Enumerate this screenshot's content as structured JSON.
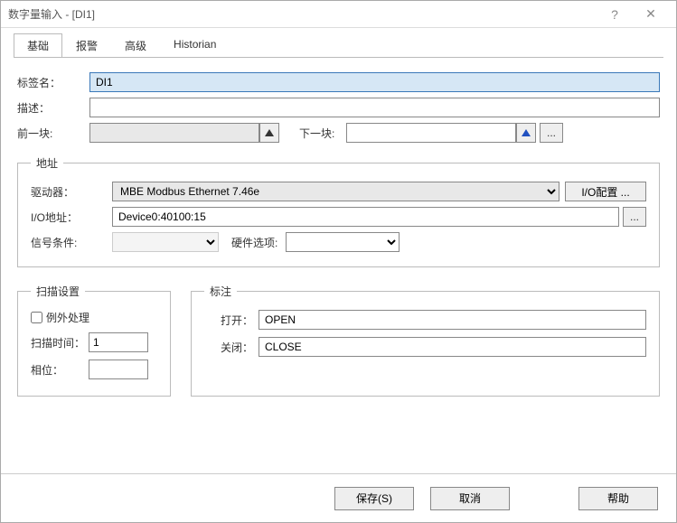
{
  "window": {
    "title": "数字量输入 - [DI1]"
  },
  "tabs": [
    "基础",
    "报警",
    "高级",
    "Historian"
  ],
  "active_tab_index": 0,
  "fields": {
    "tag_label": "标签名：",
    "tag_value": "DI1",
    "desc_label": "描述：",
    "desc_value": "",
    "prev_label": "前一块:",
    "prev_value": "",
    "next_label": "下一块:",
    "next_value": "",
    "more": "..."
  },
  "address": {
    "legend": "地址",
    "driver_label": "驱动器：",
    "driver_value": "MBE    Modbus Ethernet 7.46e",
    "iocfg_btn": "I/O配置 ...",
    "ioaddr_label": "I/O地址：",
    "ioaddr_value": "Device0:40100:15",
    "sigcond_label": "信号条件:",
    "sigcond_value": "",
    "hwopt_label": "硬件选项:",
    "hwopt_value": "",
    "more": "..."
  },
  "scan": {
    "legend": "扫描设置",
    "exception_label": "例外处理",
    "exception_checked": false,
    "time_label": "扫描时间：",
    "time_value": "1",
    "phase_label": "相位：",
    "phase_value": ""
  },
  "labeling": {
    "legend": "标注",
    "open_label": "打开：",
    "open_value": "OPEN",
    "close_label": "关闭：",
    "close_value": "CLOSE"
  },
  "buttons": {
    "save": "保存(S)",
    "cancel": "取消",
    "help": "帮助"
  },
  "titlebar_icons": {
    "help": "?",
    "close": "✕"
  }
}
